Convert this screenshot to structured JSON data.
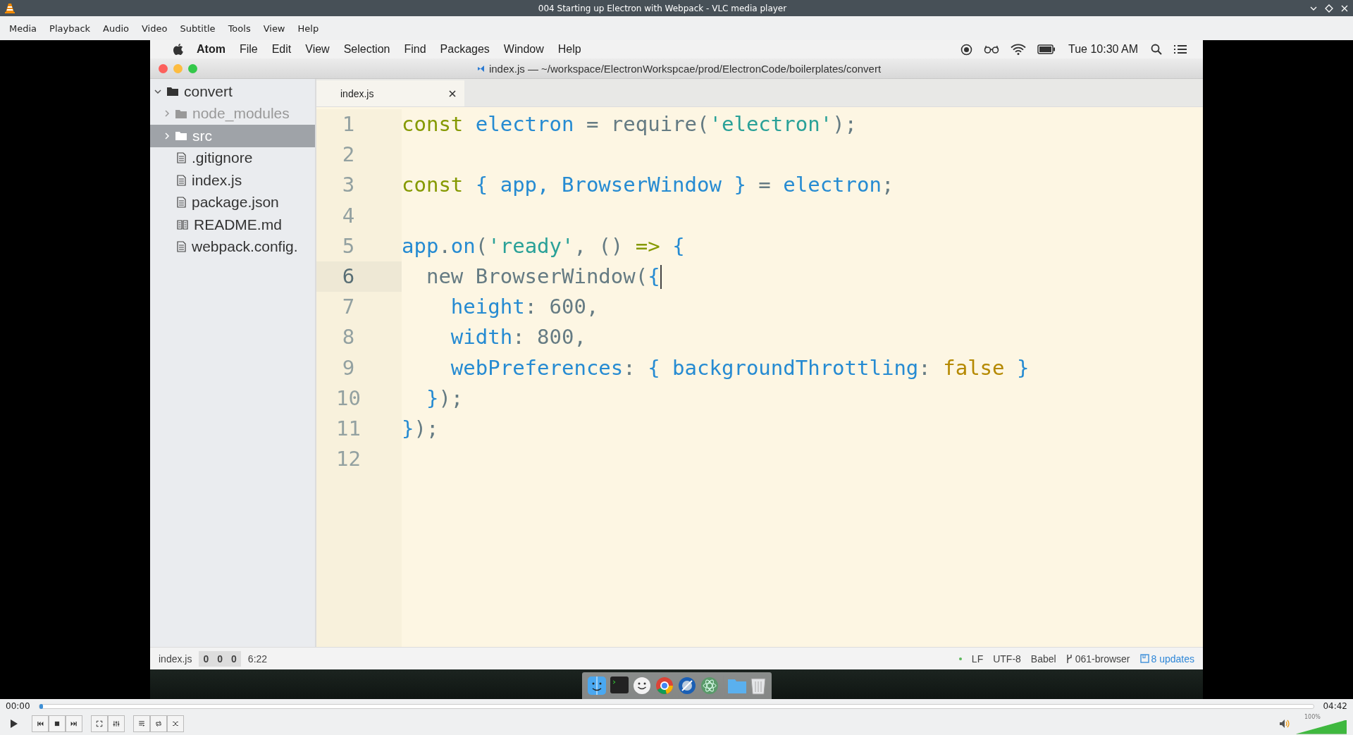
{
  "window": {
    "title": "004 Starting up Electron with Webpack - VLC media player"
  },
  "menu": [
    "Media",
    "Playback",
    "Audio",
    "Video",
    "Subtitle",
    "Tools",
    "View",
    "Help"
  ],
  "video": {
    "mac_menu": {
      "app": "Atom",
      "items": [
        "File",
        "Edit",
        "View",
        "Selection",
        "Find",
        "Packages",
        "Window",
        "Help"
      ],
      "clock": "Tue 10:30 AM"
    },
    "editor": {
      "title": "index.js — ~/workspace/ElectronWorkspcae/prod/ElectronCode/boilerplates/convert",
      "tree": {
        "label": "convert",
        "expanded": true,
        "children": [
          {
            "label": "node_modules",
            "kind": "folder",
            "dimmed": true,
            "selected": false
          },
          {
            "label": "src",
            "kind": "folder",
            "dimmed": false,
            "selected": true
          },
          {
            "label": ".gitignore",
            "kind": "file",
            "dimmed": false,
            "selected": false
          },
          {
            "label": "index.js",
            "kind": "file",
            "dimmed": false,
            "selected": false
          },
          {
            "label": "package.json",
            "kind": "file",
            "dimmed": false,
            "selected": false
          },
          {
            "label": "README.md",
            "kind": "book",
            "dimmed": false,
            "selected": false
          },
          {
            "label": "webpack.config.",
            "kind": "file",
            "dimmed": false,
            "selected": false
          }
        ]
      },
      "tabs": [
        {
          "label": "index.js",
          "selected": true
        }
      ],
      "lines": [
        {
          "number": "1",
          "current": false,
          "tokens": [
            {
              "kind": "keyword",
              "text": "const "
            },
            {
              "kind": "name",
              "text": "electron"
            },
            {
              "kind": "plain",
              "text": " = require("
            },
            {
              "kind": "string",
              "text": "'electron'"
            },
            {
              "kind": "plain",
              "text": ");"
            }
          ]
        },
        {
          "number": "2",
          "current": false
        },
        {
          "number": "3",
          "current": false,
          "tokens": [
            {
              "kind": "keyword",
              "text": "const "
            },
            {
              "kind": "name",
              "text": "{ app, BrowserWindow }"
            },
            {
              "kind": "plain",
              "text": " = "
            },
            {
              "kind": "name",
              "text": "electron"
            },
            {
              "kind": "plain",
              "text": ";"
            }
          ]
        },
        {
          "number": "4",
          "current": false
        },
        {
          "number": "5",
          "current": false,
          "tokens": [
            {
              "kind": "name",
              "text": "app"
            },
            {
              "kind": "plain",
              "text": "."
            },
            {
              "kind": "name",
              "text": "on"
            },
            {
              "kind": "plain",
              "text": "("
            },
            {
              "kind": "string",
              "text": "'ready'"
            },
            {
              "kind": "plain",
              "text": ", () "
            },
            {
              "kind": "keyword",
              "text": "=> "
            },
            {
              "kind": "name",
              "text": "{"
            }
          ]
        },
        {
          "number": "6",
          "current": true,
          "tokens": [
            {
              "kind": "plain",
              "text": "  new BrowserWindow("
            },
            {
              "kind": "name",
              "text": "{"
            }
          ]
        },
        {
          "number": "7",
          "current": false,
          "tokens": [
            {
              "kind": "name",
              "text": "    height"
            },
            {
              "kind": "plain",
              "text": ": 600,"
            }
          ]
        },
        {
          "number": "8",
          "current": false,
          "tokens": [
            {
              "kind": "name",
              "text": "    width"
            },
            {
              "kind": "plain",
              "text": ": 800,"
            }
          ]
        },
        {
          "number": "9",
          "current": false,
          "tokens": [
            {
              "kind": "name",
              "text": "    webPreferences"
            },
            {
              "kind": "plain",
              "text": ": "
            },
            {
              "kind": "name",
              "text": "{ backgroundThrottling"
            },
            {
              "kind": "plain",
              "text": ": "
            },
            {
              "kind": "constant",
              "text": "false "
            },
            {
              "kind": "name",
              "text": "}"
            }
          ]
        },
        {
          "number": "10",
          "current": false,
          "tokens": [
            {
              "kind": "name",
              "text": "  }"
            },
            {
              "kind": "plain",
              "text": ");"
            }
          ]
        },
        {
          "number": "11",
          "current": false,
          "tokens": [
            {
              "kind": "name",
              "text": "}"
            },
            {
              "kind": "plain",
              "text": ");"
            }
          ]
        },
        {
          "number": "12",
          "current": false
        }
      ],
      "status": {
        "file": "index.js",
        "counts": [
          "0",
          "0",
          "0"
        ],
        "position": "6:22",
        "line_ending": "LF",
        "encoding": "UTF-8",
        "grammar": "Babel",
        "branch": "061-browser",
        "updates": "8 updates"
      }
    }
  },
  "player": {
    "elapsed": "00:00",
    "total": "04:42",
    "seek": {
      "level": 0
    },
    "volume": {
      "level": 1,
      "reading": "100%"
    }
  }
}
